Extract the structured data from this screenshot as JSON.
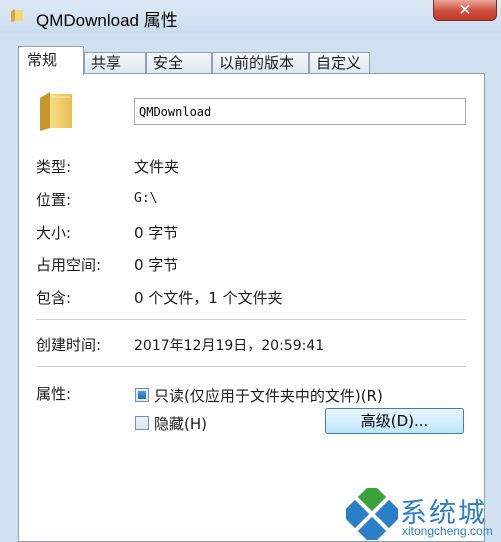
{
  "window": {
    "title": "QMDownload 属性",
    "close_symbol": "✕"
  },
  "tabs": [
    "常规",
    "共享",
    "安全",
    "以前的版本",
    "自定义"
  ],
  "general": {
    "name": "QMDownload",
    "rows": [
      {
        "label": "类型:",
        "value": "文件夹"
      },
      {
        "label": "位置:",
        "value": "G:\\"
      },
      {
        "label": "大小:",
        "value": "0 字节"
      },
      {
        "label": "占用空间:",
        "value": "0 字节"
      },
      {
        "label": "包含:",
        "value": "0 个文件，1 个文件夹"
      }
    ],
    "created": {
      "label": "创建时间:",
      "value": "2017年12月19日，20:59:41"
    },
    "attributes": {
      "label": "属性:",
      "readonly": "只读(仅应用于文件夹中的文件)(R)",
      "hidden": "隐藏(H)",
      "advanced_button": "高级(D)..."
    }
  },
  "watermark": {
    "text": "系统城",
    "sub": "xitongcheng.com"
  }
}
